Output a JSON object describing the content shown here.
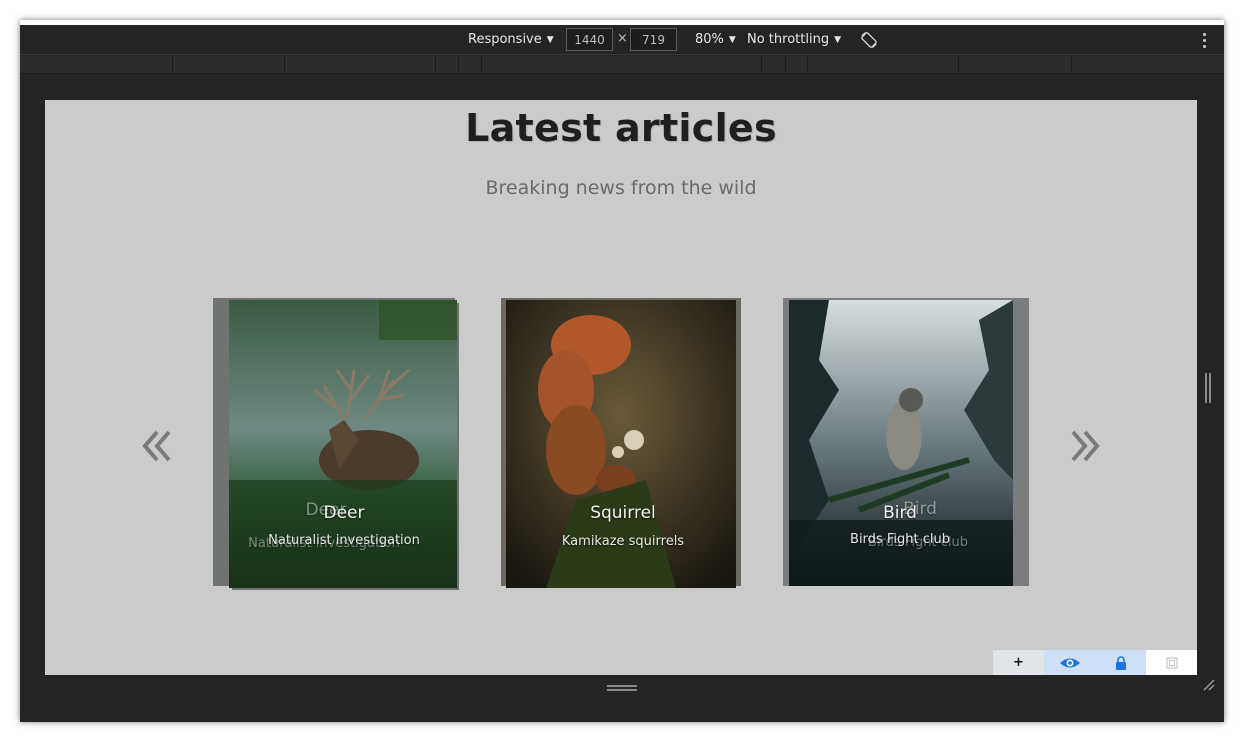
{
  "toolbar": {
    "device": "Responsive",
    "width": "1440",
    "height": "719",
    "times": "×",
    "zoom": "80%",
    "throttling": "No throttling"
  },
  "page": {
    "title": "Latest articles",
    "subtitle": "Breaking news from the wild"
  },
  "cards": [
    {
      "title": "Deer",
      "caption": "Naturalist investigation",
      "ghost_title": "Deer",
      "ghost_caption": "Naturalist investigation"
    },
    {
      "title": "Squirrel",
      "caption": "Kamikaze squirrels"
    },
    {
      "title": "Bird",
      "caption": "Birds Fight club",
      "ghost_title": "Bird",
      "ghost_caption": "Birds Fight club"
    }
  ],
  "icons": {
    "prev": "chevron-double-left-icon",
    "next": "chevron-double-right-icon",
    "rotate": "rotate-icon",
    "menu": "kebab-menu-icon",
    "add": "plus-icon",
    "view": "eye-icon",
    "lock": "lock-icon",
    "frame": "frame-icon"
  },
  "colors": {
    "devtools_bg": "#242424",
    "viewport_bg": "#cbcbcb",
    "widget_accent": "#1a73e8"
  }
}
